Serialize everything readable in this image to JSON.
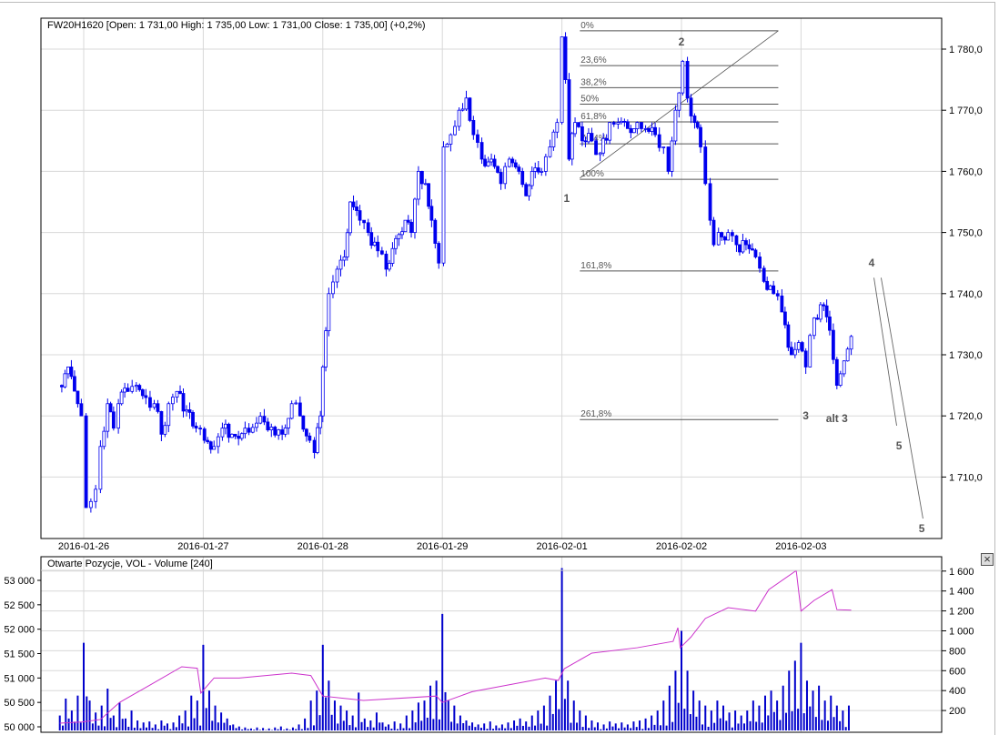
{
  "header": {
    "title": "FW20H1620 [Open: 1 731,00  High: 1 735,00  Low: 1 731,00  Close: 1 735,00] (+0,2%)"
  },
  "lower_panel": {
    "title": "Otwarte Pozycje, VOL - Volume [240]",
    "close_label": "×"
  },
  "colors": {
    "price": "#0000ee",
    "volume": "#0000cc",
    "open_interest": "#cc33cc",
    "grid": "#d8d8d8",
    "fib": "#555555"
  },
  "chart_data": [
    {
      "type": "candlestick",
      "title": "FW20H1620",
      "x_unit": "trading day index from 2016-01-26",
      "x_ticks": [
        "2016-01-26",
        "2016-01-27",
        "2016-01-28",
        "2016-01-29",
        "2016-02-01",
        "2016-02-02",
        "2016-02-03"
      ],
      "y_ticks": [
        {
          "v": 1780,
          "label": "1 780,0"
        },
        {
          "v": 1770,
          "label": "1 770,0"
        },
        {
          "v": 1760,
          "label": "1 760,0"
        },
        {
          "v": 1750,
          "label": "1 750,0"
        },
        {
          "v": 1740,
          "label": "1 740,0"
        },
        {
          "v": 1730,
          "label": "1 730,0"
        },
        {
          "v": 1720,
          "label": "1 720,0"
        },
        {
          "v": 1710,
          "label": "1 710,0"
        }
      ],
      "ylim": [
        1700,
        1785
      ],
      "grid": true,
      "price_path": [
        [
          -0.21,
          1725
        ],
        [
          -0.13,
          1728
        ],
        [
          -0.05,
          1722
        ],
        [
          -0.02,
          1720
        ],
        [
          0.02,
          1705
        ],
        [
          0.06,
          1706
        ],
        [
          0.1,
          1708
        ],
        [
          0.14,
          1715
        ],
        [
          0.2,
          1722
        ],
        [
          0.25,
          1718
        ],
        [
          0.29,
          1722
        ],
        [
          0.37,
          1724
        ],
        [
          0.44,
          1725
        ],
        [
          0.52,
          1723
        ],
        [
          0.59,
          1722
        ],
        [
          0.65,
          1717
        ],
        [
          0.71,
          1722
        ],
        [
          0.78,
          1724
        ],
        [
          0.86,
          1721
        ],
        [
          0.94,
          1718
        ],
        [
          1.01,
          1716
        ],
        [
          1.09,
          1715
        ],
        [
          1.16,
          1718
        ],
        [
          1.24,
          1717
        ],
        [
          1.35,
          1718
        ],
        [
          1.51,
          1719
        ],
        [
          1.66,
          1717
        ],
        [
          1.74,
          1722
        ],
        [
          1.81,
          1720
        ],
        [
          1.89,
          1716
        ],
        [
          1.93,
          1714
        ],
        [
          1.98,
          1720
        ],
        [
          2.0,
          1728
        ],
        [
          2.05,
          1740
        ],
        [
          2.12,
          1744
        ],
        [
          2.18,
          1746
        ],
        [
          2.23,
          1755
        ],
        [
          2.31,
          1752
        ],
        [
          2.38,
          1750
        ],
        [
          2.46,
          1747
        ],
        [
          2.53,
          1744
        ],
        [
          2.61,
          1749
        ],
        [
          2.69,
          1752
        ],
        [
          2.74,
          1750
        ],
        [
          2.8,
          1760
        ],
        [
          2.86,
          1758
        ],
        [
          2.91,
          1752
        ],
        [
          2.97,
          1745
        ],
        [
          3.01,
          1764
        ],
        [
          3.07,
          1766
        ],
        [
          3.14,
          1770
        ],
        [
          3.2,
          1772
        ],
        [
          3.26,
          1766
        ],
        [
          3.33,
          1762
        ],
        [
          3.41,
          1762
        ],
        [
          3.49,
          1758
        ],
        [
          3.56,
          1762
        ],
        [
          3.64,
          1760
        ],
        [
          3.7,
          1756
        ],
        [
          3.75,
          1760
        ],
        [
          3.83,
          1760
        ],
        [
          3.9,
          1764
        ],
        [
          3.96,
          1768
        ],
        [
          4.0,
          1782
        ],
        [
          4.03,
          1775
        ],
        [
          4.06,
          1762
        ],
        [
          4.11,
          1768
        ],
        [
          4.17,
          1765
        ],
        [
          4.25,
          1765
        ],
        [
          4.32,
          1763
        ],
        [
          4.4,
          1768
        ],
        [
          4.47,
          1768
        ],
        [
          4.55,
          1767
        ],
        [
          4.63,
          1768
        ],
        [
          4.7,
          1767
        ],
        [
          4.78,
          1766
        ],
        [
          4.85,
          1764
        ],
        [
          4.89,
          1760
        ],
        [
          4.95,
          1770
        ],
        [
          5.01,
          1778
        ],
        [
          5.05,
          1772
        ],
        [
          5.11,
          1768
        ],
        [
          5.16,
          1764
        ],
        [
          5.2,
          1758
        ],
        [
          5.24,
          1752
        ],
        [
          5.27,
          1748
        ],
        [
          5.31,
          1750
        ],
        [
          5.39,
          1750
        ],
        [
          5.46,
          1748
        ],
        [
          5.54,
          1748
        ],
        [
          5.62,
          1746
        ],
        [
          5.69,
          1742
        ],
        [
          5.77,
          1740
        ],
        [
          5.84,
          1737
        ],
        [
          5.92,
          1730
        ],
        [
          5.98,
          1732
        ],
        [
          6.04,
          1728
        ],
        [
          6.11,
          1736
        ],
        [
          6.19,
          1738
        ],
        [
          6.24,
          1734
        ],
        [
          6.3,
          1725
        ],
        [
          6.36,
          1729
        ],
        [
          6.42,
          1733
        ]
      ],
      "fibonacci": {
        "t_range": [
          4.15,
          5.81
        ],
        "levels": [
          {
            "label": "0%",
            "price": 1783.0
          },
          {
            "label": "23,6%",
            "price": 1777.3
          },
          {
            "label": "38,2%",
            "price": 1773.7
          },
          {
            "label": "50%",
            "price": 1771.0
          },
          {
            "label": "61,8%",
            "price": 1768.1
          },
          {
            "label": "76,4%",
            "price": 1764.5
          },
          {
            "label": "100%",
            "price": 1758.7
          },
          {
            "label": "161,8%",
            "price": 1743.7
          },
          {
            "label": "261,8%",
            "price": 1719.4
          }
        ],
        "trend_line": [
          [
            4.15,
            1758.9
          ],
          [
            5.81,
            1783.0
          ]
        ]
      },
      "annotations": [
        {
          "text": "1",
          "t": 4.04,
          "price": 1755.6
        },
        {
          "text": "2",
          "t": 5.0,
          "price": 1781.2
        },
        {
          "text": "3",
          "t": 6.04,
          "price": 1720.0
        },
        {
          "text": "alt 3",
          "t": 6.3,
          "price": 1719.6
        },
        {
          "text": "4",
          "t": 6.59,
          "price": 1745.0
        },
        {
          "text": "5",
          "t": 6.82,
          "price": 1715.1
        },
        {
          "text": "5",
          "t": 7.01,
          "price": 1701.6
        }
      ],
      "projection_lines": [
        [
          [
            6.61,
            1742.6
          ],
          [
            6.8,
            1718.4
          ]
        ],
        [
          [
            6.67,
            1742.6
          ],
          [
            7.02,
            1703.2
          ]
        ]
      ]
    },
    {
      "type": "bar+line",
      "title": "Otwarte Pozycje, VOL - Volume [240]",
      "left_ticks": [
        {
          "v": 53000,
          "label": "53 000"
        },
        {
          "v": 52500,
          "label": "52 500"
        },
        {
          "v": 52000,
          "label": "52 000"
        },
        {
          "v": 51500,
          "label": "51 500"
        },
        {
          "v": 51000,
          "label": "51 000"
        },
        {
          "v": 50500,
          "label": "50 500"
        },
        {
          "v": 50000,
          "label": "50 000"
        }
      ],
      "right_ticks": [
        {
          "v": 1600,
          "label": "1 600"
        },
        {
          "v": 1400,
          "label": "1 400"
        },
        {
          "v": 1200,
          "label": "1 200"
        },
        {
          "v": 1000,
          "label": "1 000"
        },
        {
          "v": 800,
          "label": "800"
        },
        {
          "v": 600,
          "label": "600"
        },
        {
          "v": 400,
          "label": "400"
        },
        {
          "v": 200,
          "label": "200"
        }
      ],
      "volume_t_start": -0.2,
      "volume_t_step": 0.05,
      "volume": [
        150,
        320,
        200,
        350,
        880,
        300,
        180,
        250,
        420,
        150,
        280,
        120,
        200,
        100,
        80,
        90,
        60,
        100,
        70,
        80,
        150,
        200,
        350,
        300,
        860,
        400,
        250,
        180,
        120,
        60,
        40,
        30,
        20,
        30,
        25,
        20,
        30,
        40,
        20,
        30,
        60,
        120,
        300,
        400,
        860,
        500,
        300,
        250,
        200,
        150,
        380,
        120,
        100,
        180,
        80,
        60,
        90,
        70,
        150,
        200,
        280,
        300,
        450,
        500,
        1170,
        300,
        250,
        150,
        100,
        80,
        60,
        70,
        90,
        50,
        60,
        80,
        100,
        120,
        90,
        150,
        200,
        250,
        350,
        500,
        1630,
        500,
        300,
        200,
        150,
        100,
        80,
        60,
        90,
        70,
        80,
        60,
        90,
        100,
        120,
        150,
        200,
        300,
        450,
        600,
        1000,
        600,
        400,
        300,
        250,
        200,
        300,
        250,
        180,
        200,
        150,
        200,
        300,
        250,
        350,
        400,
        300,
        450,
        600,
        700,
        880,
        500,
        400,
        450,
        300,
        350,
        250,
        200,
        250
      ],
      "open_interest": [
        [
          -0.2,
          50075
        ],
        [
          -0.01,
          50100
        ],
        [
          0.14,
          50150
        ],
        [
          0.3,
          50500
        ],
        [
          0.55,
          50850
        ],
        [
          0.82,
          51230
        ],
        [
          0.95,
          51200
        ],
        [
          0.98,
          50690
        ],
        [
          1.09,
          51000
        ],
        [
          1.3,
          51000
        ],
        [
          1.74,
          51100
        ],
        [
          1.9,
          51050
        ],
        [
          2.0,
          50630
        ],
        [
          2.34,
          50540
        ],
        [
          2.95,
          50630
        ],
        [
          3.0,
          50500
        ],
        [
          3.25,
          50720
        ],
        [
          3.86,
          51000
        ],
        [
          3.97,
          50950
        ],
        [
          4.02,
          51190
        ],
        [
          4.25,
          51510
        ],
        [
          4.63,
          51620
        ],
        [
          4.93,
          51750
        ],
        [
          4.97,
          52030
        ],
        [
          4.99,
          51620
        ],
        [
          5.08,
          51840
        ],
        [
          5.2,
          52220
        ],
        [
          5.39,
          52440
        ],
        [
          5.62,
          52370
        ],
        [
          5.73,
          52810
        ],
        [
          5.96,
          53200
        ],
        [
          6.0,
          52370
        ],
        [
          6.11,
          52590
        ],
        [
          6.26,
          52810
        ],
        [
          6.3,
          52400
        ],
        [
          6.42,
          52390
        ]
      ]
    }
  ]
}
